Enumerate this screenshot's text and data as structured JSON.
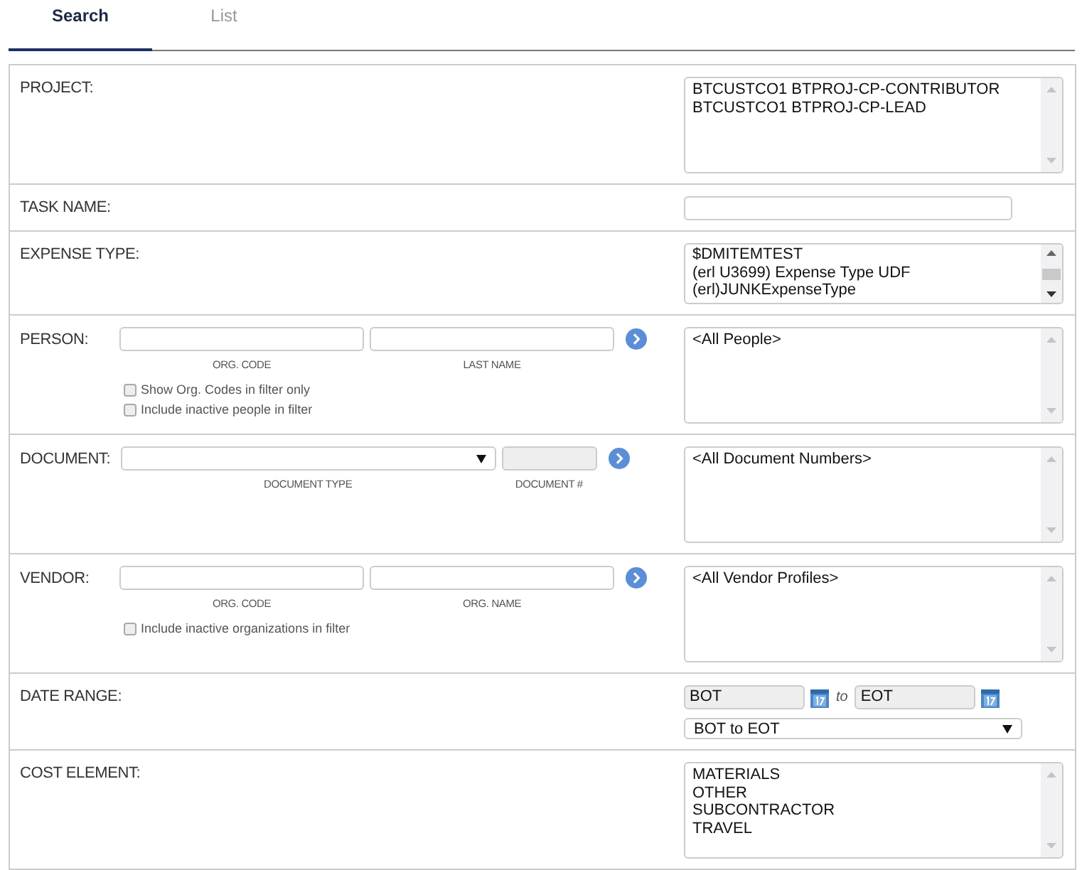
{
  "tabs": [
    {
      "label": "Search",
      "selected": true
    },
    {
      "label": "List",
      "selected": false
    }
  ],
  "rows": [
    {
      "kind": "list",
      "label": "PROJECT:",
      "items": [
        "BTCUSTCO1 BTPROJ-CP-CONTRIBUTOR",
        "BTCUSTCO1 BTPROJ-CP-LEAD"
      ]
    },
    {
      "kind": "text",
      "label": "TASK NAME:"
    },
    {
      "kind": "short-list",
      "label": "EXPENSE TYPE:",
      "items": [
        "$DMITEMTEST",
        "(erl U3699) Expense Type UDF",
        "(erl)JUNKExpenseType"
      ]
    },
    {
      "kind": "lookup",
      "label": "PERSON:",
      "fields": [
        {
          "kind": "input",
          "caption": "ORG. CODE",
          "disabled": false
        },
        {
          "kind": "input",
          "caption": "LAST NAME",
          "disabled": false
        }
      ],
      "checkboxes": [
        {
          "label": "Show Org. Codes in filter only",
          "checked": false
        },
        {
          "label": "Include inactive people in filter",
          "checked": false
        }
      ],
      "items": [
        "<All People>"
      ]
    },
    {
      "kind": "lookup",
      "label": "DOCUMENT:",
      "fields": [
        {
          "kind": "select",
          "caption": "DOCUMENT TYPE",
          "disabled": false
        },
        {
          "kind": "input",
          "caption": "DOCUMENT #",
          "disabled": true
        }
      ],
      "checkboxes": [],
      "items": [
        "<All Document Numbers>"
      ]
    },
    {
      "kind": "lookup",
      "label": "VENDOR:",
      "fields": [
        {
          "kind": "input",
          "caption": "ORG. CODE",
          "disabled": false
        },
        {
          "kind": "input",
          "caption": "ORG. NAME",
          "disabled": false
        }
      ],
      "checkboxes": [
        {
          "label": "Include inactive organizations in filter",
          "checked": false
        }
      ],
      "items": [
        "<All Vendor Profiles>"
      ]
    },
    {
      "kind": "date",
      "label": "DATE RANGE:",
      "from": "BOT",
      "separator": "to",
      "to": "EOT",
      "range": "BOT to EOT"
    },
    {
      "kind": "list",
      "label": "COST ELEMENT:",
      "items": [
        "MATERIALS",
        "OTHER",
        "SUBCONTRACTOR",
        "TRAVEL"
      ]
    }
  ]
}
